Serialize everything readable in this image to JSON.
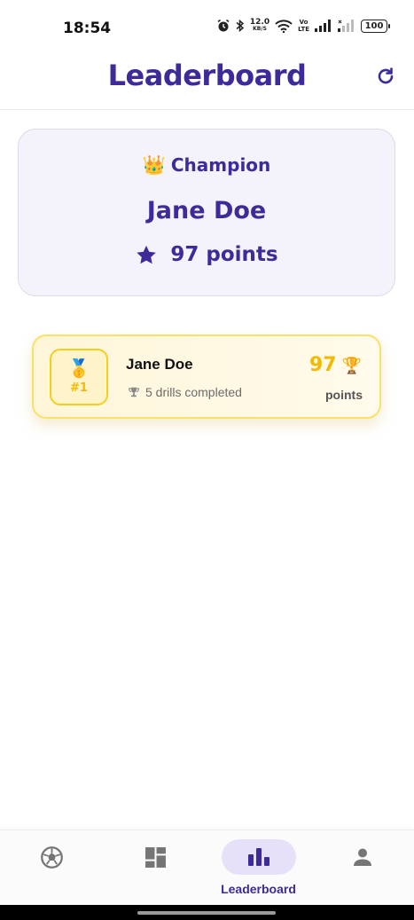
{
  "status_bar": {
    "time": "18:54",
    "network_speed_value": "12.0",
    "network_speed_unit": "KB/S",
    "volte_top": "Vo",
    "volte_bottom": "LTE",
    "battery": "100"
  },
  "header": {
    "title": "Leaderboard",
    "refresh_icon": "refresh-icon"
  },
  "champion": {
    "icon": "crown-icon",
    "label": "Champion",
    "name": "Jane Doe",
    "points_text": "97 points"
  },
  "leaderboard": [
    {
      "rank_label": "#1",
      "medal_icon": "gold-medal-icon",
      "name": "Jane Doe",
      "drills_text": "5 drills completed",
      "score": "97",
      "score_unit": "points",
      "trophy_icon": "trophy-icon"
    }
  ],
  "bottom_nav": {
    "items": [
      {
        "icon": "soccer-ball-icon",
        "label": "",
        "active": false
      },
      {
        "icon": "dashboard-icon",
        "label": "",
        "active": false
      },
      {
        "icon": "bar-chart-icon",
        "label": "Leaderboard",
        "active": true
      },
      {
        "icon": "person-icon",
        "label": "",
        "active": false
      }
    ]
  },
  "colors": {
    "primary": "#3f2a9a",
    "gold": "#f2b900",
    "active_nav_bg": "#e6e1f8",
    "card_bg": "#f4f2fa"
  }
}
